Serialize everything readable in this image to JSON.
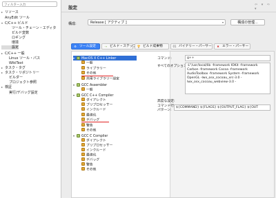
{
  "sidebar": {
    "filter_placeholder": "フィルター入力",
    "items": [
      {
        "label": "リソース",
        "tw": "▸"
      },
      {
        "label": "AnyEdit ツール",
        "tw": ""
      },
      {
        "label": "C/C++ ビルド",
        "tw": "▾"
      },
      {
        "label": "ツール・チェーン・エディタ",
        "tw": ""
      },
      {
        "label": "ビルド変数",
        "tw": ""
      },
      {
        "label": "ロギング",
        "tw": ""
      },
      {
        "label": "環境",
        "tw": ""
      },
      {
        "label": "設定",
        "tw": ""
      },
      {
        "label": "C/C++ 一般",
        "tw": "▸"
      },
      {
        "label": "Linux ツール・パス",
        "tw": ""
      },
      {
        "label": "WikiText",
        "tw": ""
      },
      {
        "label": "タスク・タグ",
        "tw": "▸"
      },
      {
        "label": "タスク・リポジトリー",
        "tw": "▸"
      },
      {
        "label": "ビルダー",
        "tw": ""
      },
      {
        "label": "プロジェクト参照",
        "tw": ""
      },
      {
        "label": "検証",
        "tw": "▸"
      },
      {
        "label": "実行/デバッグ設定",
        "tw": ""
      }
    ]
  },
  "header": {
    "title": "設定",
    "nav_icons": "⇦ ▾ ⇨ ▾"
  },
  "config": {
    "label": "構成:",
    "value": "Release [ アクティブ ]",
    "manage_button": "構成の管理..."
  },
  "tabs": [
    {
      "label": "ツール設定",
      "icon": "⚙"
    },
    {
      "label": "ビルド・ステップ",
      "icon": "⇢"
    },
    {
      "label": "ビルド成果物",
      "icon": "🏆"
    },
    {
      "label": "バイナリー・パーサー",
      "icon": "01"
    },
    {
      "label": "エラー・パーサー",
      "icon": "✖"
    }
  ],
  "tree": [
    {
      "label": "MacOS X C++ Linker",
      "level": 0,
      "arrow": "▾",
      "icon": "tool",
      "selected": true
    },
    {
      "label": "一般",
      "level": 1,
      "arrow": "",
      "icon": "cat"
    },
    {
      "label": "ライブラリー",
      "level": 1,
      "arrow": "",
      "icon": "cat"
    },
    {
      "label": "その他",
      "level": 1,
      "arrow": "",
      "icon": "cat"
    },
    {
      "label": "共用ライブラリー設定",
      "level": 1,
      "arrow": "",
      "icon": "cat"
    },
    {
      "label": "GCC Assembler",
      "level": 0,
      "arrow": "▾",
      "icon": "tool"
    },
    {
      "label": "一般",
      "level": 1,
      "arrow": "",
      "icon": "cat"
    },
    {
      "label": "GCC C++ Compiler",
      "level": 0,
      "arrow": "▾",
      "icon": "tool"
    },
    {
      "label": "ダイアレクト",
      "level": 1,
      "arrow": "",
      "icon": "cat"
    },
    {
      "label": "プリプロセッサー",
      "level": 1,
      "arrow": "",
      "icon": "cat"
    },
    {
      "label": "インクルード",
      "level": 1,
      "arrow": "",
      "icon": "cat"
    },
    {
      "label": "最適化",
      "level": 1,
      "arrow": "",
      "icon": "cat"
    },
    {
      "label": "デバッグ",
      "level": 1,
      "arrow": "",
      "icon": "cat"
    },
    {
      "label": "警告",
      "level": 1,
      "arrow": "",
      "icon": "cat"
    },
    {
      "label": "その他",
      "level": 1,
      "arrow": "",
      "icon": "cat"
    },
    {
      "label": "GCC C Compiler",
      "level": 0,
      "arrow": "▾",
      "icon": "tool"
    },
    {
      "label": "ダイアレクト",
      "level": 1,
      "arrow": "",
      "icon": "cat"
    },
    {
      "label": "プリプロセッサー",
      "level": 1,
      "arrow": "",
      "icon": "cat"
    },
    {
      "label": "インクルード",
      "level": 1,
      "arrow": "",
      "icon": "cat"
    },
    {
      "label": "最適化",
      "level": 1,
      "arrow": "",
      "icon": "cat"
    },
    {
      "label": "デバッグ",
      "level": 1,
      "arrow": "",
      "icon": "cat"
    },
    {
      "label": "警告",
      "level": 1,
      "arrow": "",
      "icon": "cat"
    },
    {
      "label": "その他",
      "level": 1,
      "arrow": "",
      "icon": "cat"
    }
  ],
  "settings": {
    "command_label": "コマンド:",
    "command_value": "g++",
    "all_options_label": "すべてのオプション:",
    "all_options_value": "-L\"/usr/local/lib -framework IOKit -framework Carbon -framework Cocoa -framework AudioToolbox -framework System -framework OpenGL -lwx_osx_cocoau_xrc-3.0 -lwx_osx_cocoau_webview-3.0 -",
    "expert_label": "高度な設定:",
    "pattern_label_1": "コマンド行",
    "pattern_label_2": "パターン:",
    "pattern_value": "${COMMAND} ${FLAGS} ${OUTPUT_FLAG} ${OUT"
  },
  "colors": {
    "selection": "#2f6fd6",
    "tab_active": "#3b82f6",
    "annotation": "#e02020"
  }
}
